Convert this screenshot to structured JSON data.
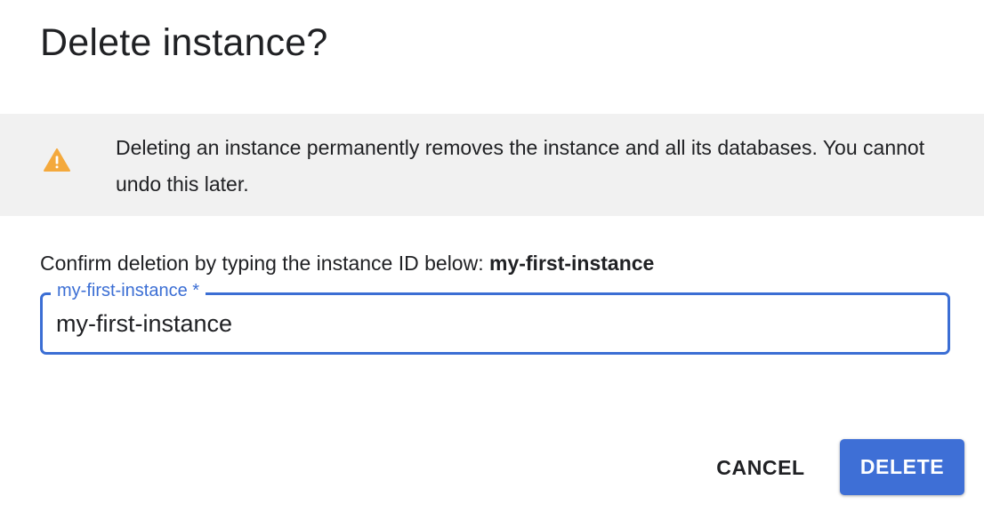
{
  "dialog": {
    "title": "Delete instance?"
  },
  "warning": {
    "icon": "warning-icon",
    "icon_color": "#f4a93c",
    "text": "Deleting an instance permanently removes the instance and all its databases. You cannot undo this later."
  },
  "confirm": {
    "prompt": "Confirm deletion by typing the instance ID below: ",
    "instance_id": "my-first-instance"
  },
  "field": {
    "label": "my-first-instance *",
    "value": "my-first-instance",
    "accent_color": "#3b6ed4"
  },
  "actions": {
    "cancel_label": "CANCEL",
    "delete_label": "DELETE",
    "delete_color": "#3e6fd6"
  }
}
